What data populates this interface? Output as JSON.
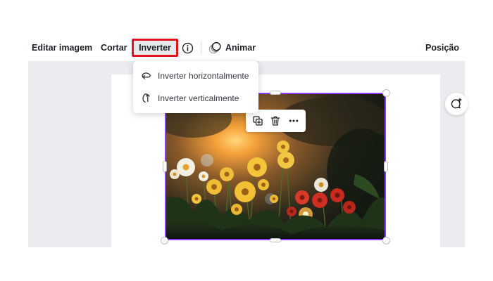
{
  "toolbar": {
    "edit_image": "Editar imagem",
    "crop": "Cortar",
    "flip": "Inverter",
    "info_icon": "info-icon",
    "animate": "Animar",
    "position": "Posição"
  },
  "flip_menu": {
    "items": [
      {
        "label": "Inverter horizontalmente",
        "icon": "flip-horizontal-icon"
      },
      {
        "label": "Inverter verticalmente",
        "icon": "flip-vertical-icon"
      }
    ]
  },
  "element_toolbar": {
    "icons": [
      "duplicate-icon",
      "trash-icon",
      "more-icon"
    ]
  },
  "canvas": {
    "image_subject": "yellow and red flowers at sunset",
    "selection_color": "#8b3dff"
  },
  "colors": {
    "highlight_border": "#e0141e",
    "canvas_bg": "#ebecf0"
  }
}
